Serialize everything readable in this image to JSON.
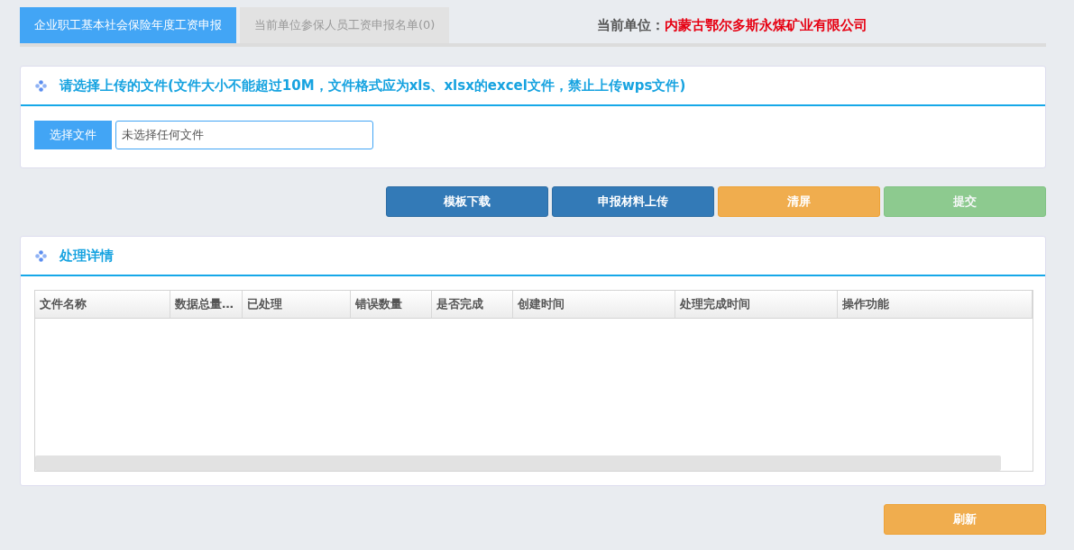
{
  "tabs": [
    {
      "label": "企业职工基本社会保险年度工资申报",
      "selected": true
    },
    {
      "label": "当前单位参保人员工资申报名单(0)",
      "selected": false
    }
  ],
  "current_unit": {
    "label": "当前单位：",
    "value": "内蒙古鄂尔多斯永煤矿业有限公司"
  },
  "upload_panel": {
    "title": "请选择上传的文件(文件大小不能超过10M，文件格式应为xls、xlsx的excel文件，禁止上传wps文件)",
    "choose_button": "选择文件",
    "file_field": {
      "value": "未选择任何文件"
    }
  },
  "actions": [
    {
      "label": "模板下载",
      "kind": "primary",
      "disabled": false
    },
    {
      "label": "申报材料上传",
      "kind": "primary",
      "disabled": false
    },
    {
      "label": "清屏",
      "kind": "warning",
      "disabled": false
    },
    {
      "label": "提交",
      "kind": "success",
      "disabled": true
    }
  ],
  "details_panel": {
    "title": "处理详情",
    "table": {
      "columns": [
        "文件名称",
        "数据总量…",
        "已处理",
        "错误数量",
        "是否完成",
        "创建时间",
        "处理完成时间",
        "操作功能"
      ]
    }
  },
  "refresh_button": {
    "label": "刷新",
    "kind": "warning"
  }
}
